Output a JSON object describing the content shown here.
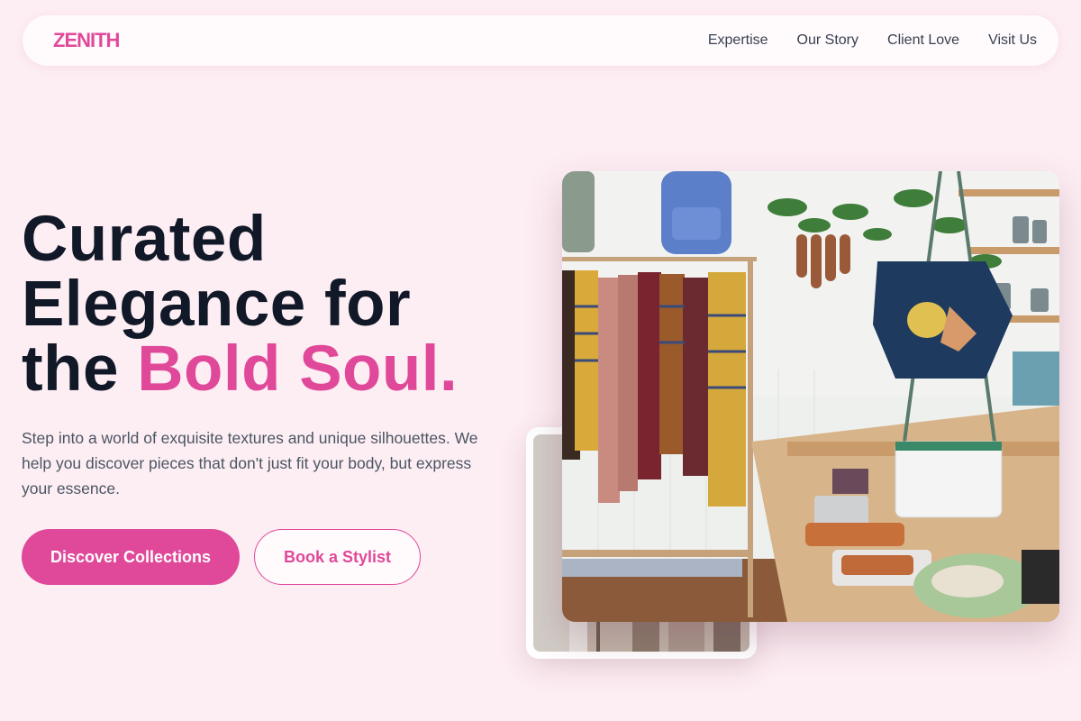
{
  "brand": {
    "logo": "ZENITH",
    "accent_color": "#e0499a"
  },
  "nav": {
    "links": [
      "Expertise",
      "Our Story",
      "Client Love",
      "Visit Us"
    ]
  },
  "hero": {
    "title_line1": "Curated",
    "title_line2": "Elegance for",
    "title_line3_plain": "the ",
    "title_line3_accent": "Bold Soul.",
    "description": "Step into a world of exquisite textures and unique silhouettes. We help you discover pieces that don't just fit your body, but express your essence.",
    "primary_button": "Discover Collections",
    "secondary_button": "Book a Stylist"
  },
  "images": {
    "main_photo": "boutique-interior-photo",
    "back_photo": "clothing-rack-photo"
  }
}
